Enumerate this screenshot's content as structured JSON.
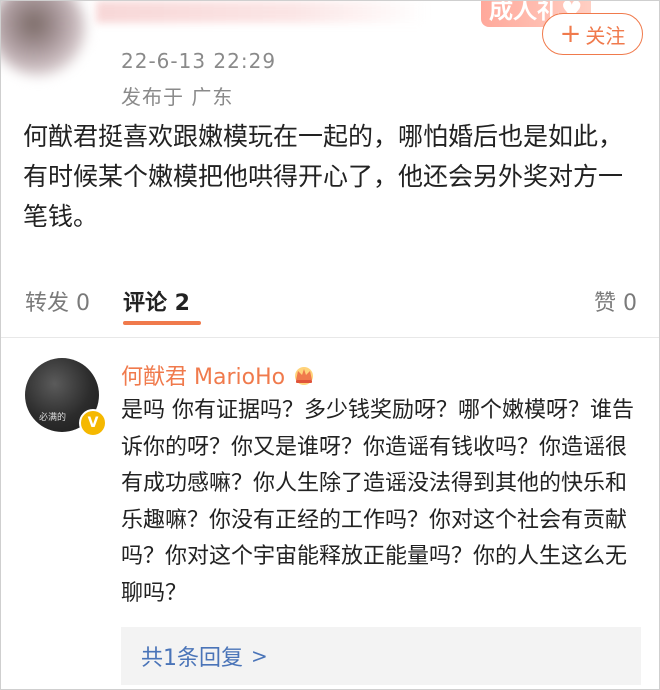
{
  "post": {
    "time": "22-6-13 22:29",
    "location": "发布于 广东",
    "follow_label": "关注",
    "banner_text": "成人礼♥",
    "text": "何猷君挺喜欢跟嫩模玩在一起的，哪怕婚后也是如此，有时候某个嫩模把他哄得开心了，他还会另外奖对方一笔钱。"
  },
  "tabs": {
    "repost": "转发 0",
    "comments": "评论 2",
    "like": "赞 0"
  },
  "comment": {
    "author": "何猷君 MarioHo",
    "avatar_watermark": "必满的",
    "verified_badge": "V",
    "text": "是吗 你有证据吗？多少钱奖励呀？哪个嫩模呀？谁告诉你的呀？你又是谁呀？你造谣有钱收吗？你造谣很有成功感嘛？你人生除了造谣没法得到其他的快乐和乐趣嘛？你没有正经的工作吗？你对这个社会有贡献吗？你对这个宇宙能释放正能量吗？你的人生这么无聊吗？",
    "replies_label": "共1条回复",
    "replies_chevron": ">"
  },
  "colors": {
    "accent": "#f07a4c",
    "link": "#4a74b8",
    "verified": "#f5b800"
  }
}
